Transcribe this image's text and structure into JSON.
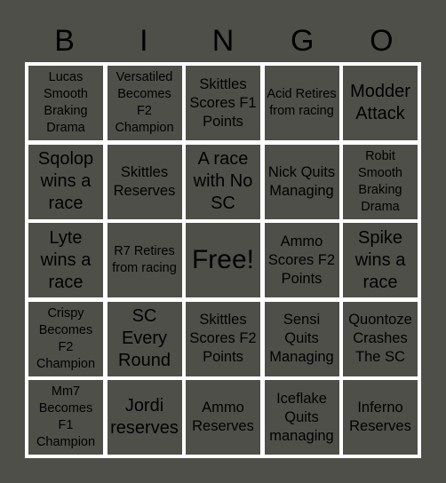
{
  "header": [
    "B",
    "I",
    "N",
    "G",
    "O"
  ],
  "cells": [
    {
      "text": "Lucas Smooth Braking Drama",
      "size": "sm"
    },
    {
      "text": "Versatiled Becomes F2 Champion",
      "size": "sm"
    },
    {
      "text": "Skittles Scores F1 Points",
      "size": "md"
    },
    {
      "text": "Acid Retires from racing",
      "size": "sm"
    },
    {
      "text": "Modder Attack",
      "size": "lg"
    },
    {
      "text": "Sqolop wins a race",
      "size": "lg"
    },
    {
      "text": "Skittles Reserves",
      "size": "md"
    },
    {
      "text": "A race with No SC",
      "size": "lg"
    },
    {
      "text": "Nick Quits Managing",
      "size": "md"
    },
    {
      "text": "Robit Smooth Braking Drama",
      "size": "sm"
    },
    {
      "text": "Lyte wins a race",
      "size": "lg"
    },
    {
      "text": "R7 Retires from racing",
      "size": "sm"
    },
    {
      "text": "Free!",
      "size": "xl"
    },
    {
      "text": "Ammo Scores F2 Points",
      "size": "md"
    },
    {
      "text": "Spike wins a race",
      "size": "lg"
    },
    {
      "text": "Crispy Becomes F2 Champion",
      "size": "sm"
    },
    {
      "text": "SC Every Round",
      "size": "lg"
    },
    {
      "text": "Skittles Scores F2 Points",
      "size": "md"
    },
    {
      "text": "Sensi Quits Managing",
      "size": "md"
    },
    {
      "text": "Quontoze Crashes The SC",
      "size": "md"
    },
    {
      "text": "Mm7 Becomes F1 Champion",
      "size": "sm"
    },
    {
      "text": "Jordi reserves",
      "size": "lg"
    },
    {
      "text": "Ammo Reserves",
      "size": "md"
    },
    {
      "text": "Iceflake Quits managing",
      "size": "md"
    },
    {
      "text": "Inferno Reserves",
      "size": "md"
    }
  ],
  "colors": {
    "background": "#4f4f4a",
    "grid_lines": "#ffffff",
    "text": "#000000"
  }
}
